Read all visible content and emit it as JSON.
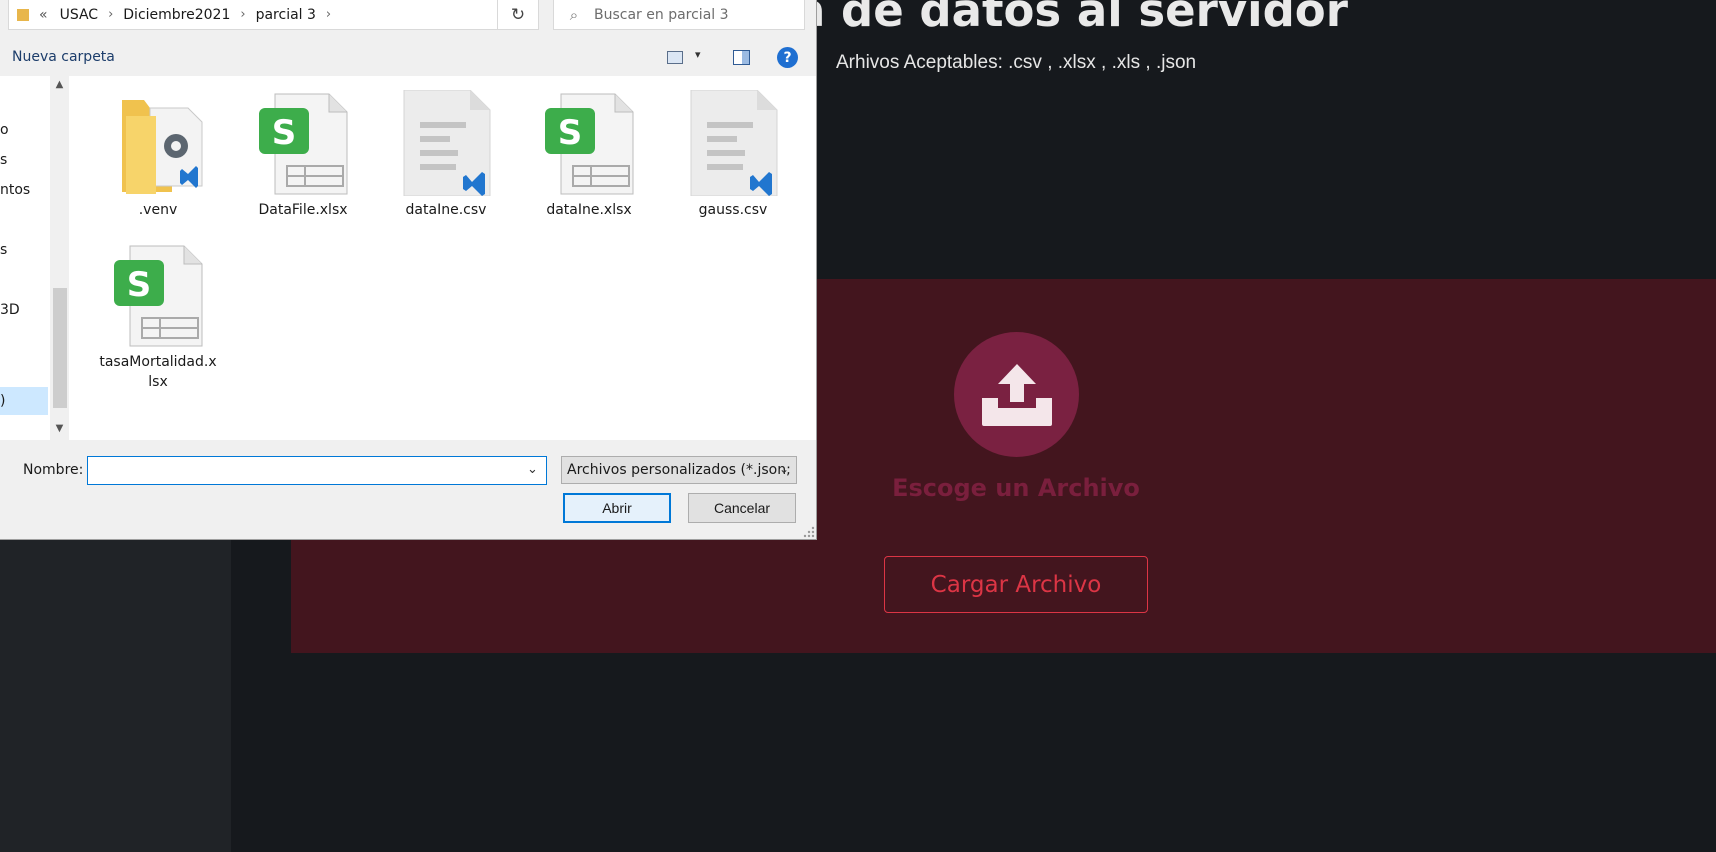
{
  "app": {
    "heading": "a de datos al servidor",
    "accepted_files": "Arhivos Aceptables: .csv , .xlsx , .xls , .json",
    "choose_file": "Escoge un Archivo",
    "load_button": "Cargar Archivo",
    "colors": {
      "panel": "#43151e",
      "circle": "#7a2141",
      "accent": "#dc3545"
    }
  },
  "dialog": {
    "breadcrumb": {
      "overflow": "«",
      "items": [
        "USAC",
        "Diciembre2021",
        "parcial 3"
      ]
    },
    "search_placeholder": "Buscar en parcial 3",
    "new_folder": "Nueva carpeta",
    "nav_items": [
      "o",
      "s",
      "ntos",
      "",
      "s",
      "3D",
      ")"
    ],
    "files": [
      {
        "name": ".venv",
        "type": "folder-icon"
      },
      {
        "name": "DataFile.xlsx",
        "type": "spreadsheet-icon"
      },
      {
        "name": "dataIne.csv",
        "type": "vscode-file-icon"
      },
      {
        "name": "dataIne.xlsx",
        "type": "spreadsheet-icon"
      },
      {
        "name": "gauss.csv",
        "type": "vscode-file-icon"
      },
      {
        "name": "tasaMortalidad.xlsx",
        "type": "spreadsheet-icon"
      }
    ],
    "name_label": "Nombre:",
    "name_value": "",
    "filter": "Archivos personalizados (*.json;",
    "open_button": "Abrir",
    "cancel_button": "Cancelar"
  }
}
